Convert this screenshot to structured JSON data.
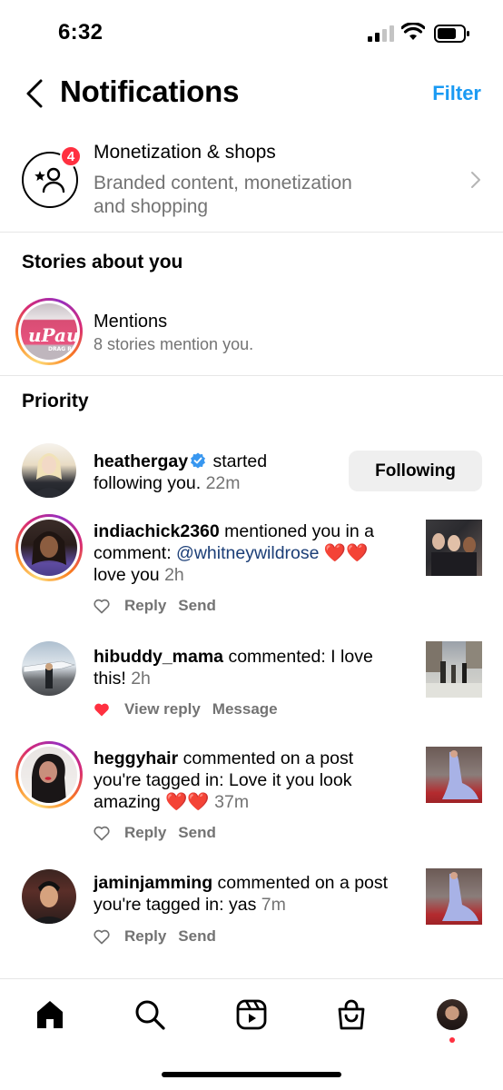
{
  "status_bar": {
    "time": "6:32"
  },
  "header": {
    "title": "Notifications",
    "filter_label": "Filter"
  },
  "monetization": {
    "title": "Monetization & shops",
    "subtitle": "Branded content, monetization and shopping",
    "badge_count": "4"
  },
  "stories_section": {
    "heading": "Stories about you",
    "mentions_title": "Mentions",
    "mentions_subtitle": "8 stories mention you."
  },
  "priority_section": {
    "heading": "Priority"
  },
  "notifications": [
    {
      "username": "heathergay",
      "verified": true,
      "text": " started following you.",
      "time": "22m",
      "button_label": "Following"
    },
    {
      "username": "indiachick2360",
      "text_before": " mentioned you in a comment: ",
      "mention": "@whitneywildrose",
      "emoji": " ❤️❤️",
      "text_after": "love you",
      "time": "2h",
      "actions": [
        "Reply",
        "Send"
      ]
    },
    {
      "username": "hibuddy_mama",
      "text": " commented: I love this!",
      "time": "2h",
      "liked": true,
      "actions": [
        "View reply",
        "Message"
      ]
    },
    {
      "username": "heggyhair",
      "text": " commented on a post you're tagged in: Love it you look amazing",
      "emoji": "❤️❤️",
      "time": "37m",
      "actions": [
        "Reply",
        "Send"
      ]
    },
    {
      "username": "jaminjamming",
      "text": " commented on a post you're tagged in: yas",
      "time": "7m",
      "actions": [
        "Reply",
        "Send"
      ]
    }
  ],
  "tab_bar": {
    "icons": [
      "home-icon",
      "search-icon",
      "reels-icon",
      "shop-icon",
      "profile-avatar"
    ],
    "accent": "#ff3040"
  },
  "colors": {
    "link": "#1a9af3",
    "badge": "#ff3040",
    "secondary_text": "#737373"
  }
}
